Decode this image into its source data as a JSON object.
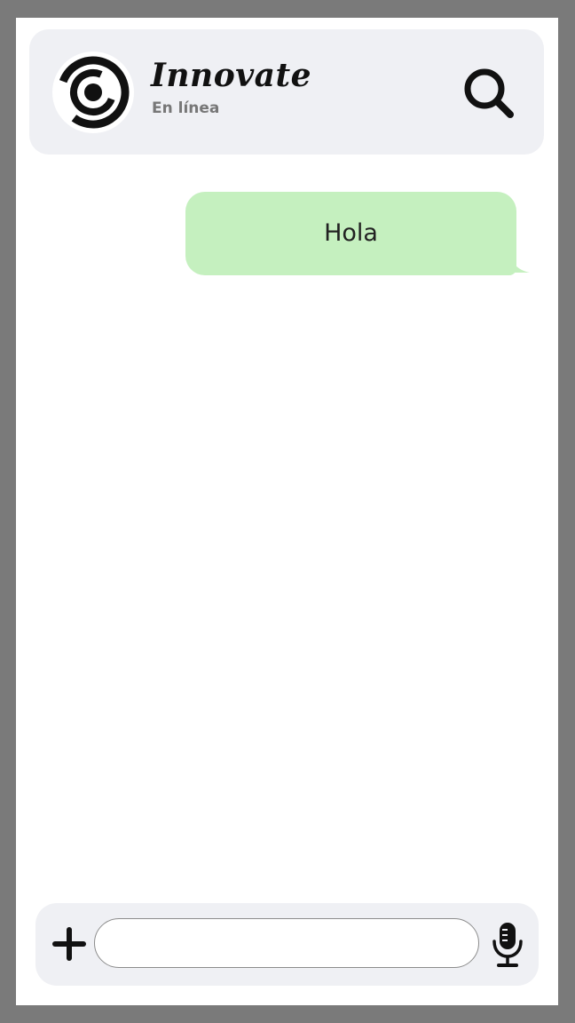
{
  "header": {
    "avatar_icon": "swirl-logo-icon",
    "title": "Innovate",
    "status": "En línea",
    "search_icon": "search-icon"
  },
  "messages": [
    {
      "text": "Hola",
      "direction": "outgoing",
      "bubble_color": "#c5f0bf"
    }
  ],
  "composer": {
    "add_icon": "plus-icon",
    "input_value": "",
    "input_placeholder": "",
    "mic_icon": "microphone-icon"
  },
  "colors": {
    "frame": "#7a7a7a",
    "panel": "#eff0f4",
    "outgoing_bubble": "#c5f0bf",
    "text_dark": "#111111",
    "text_muted": "#777777"
  }
}
